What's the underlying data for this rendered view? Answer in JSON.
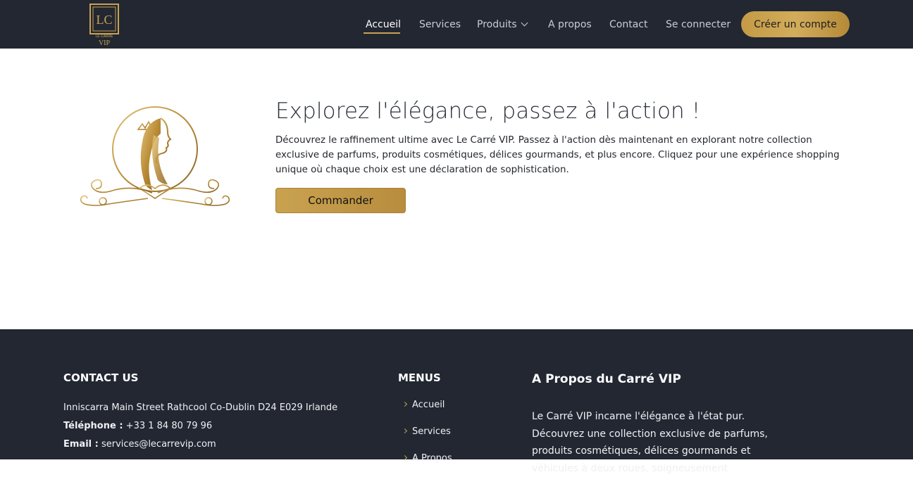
{
  "brand": {
    "logo_letters": "LC",
    "logo_small": "LE CARRÉ",
    "logo_vip": "VIP",
    "gold": "#c9a250",
    "dark": "#222732"
  },
  "nav": {
    "items": [
      {
        "label": "Accueil",
        "active": true
      },
      {
        "label": "Services"
      },
      {
        "label": "Produits",
        "has_dropdown": true
      },
      {
        "label": "A propos"
      },
      {
        "label": "Contact"
      },
      {
        "label": "Se connecter"
      }
    ],
    "cta_label": "Créer un compte"
  },
  "hero": {
    "title": "Explorez l'élégance, passez à l'action !",
    "text": "Découvrez le raffinement ultime avec Le Carré VIP. Passez à l'action dès maintenant en explorant notre collection exclusive de parfums, produits cosmétiques, délices gourmands, et plus encore. Cliquez pour une expérience shopping unique où chaque choix est une déclaration de sophistication.",
    "button_label": "Commander"
  },
  "footer": {
    "contact": {
      "heading": "CONTACT US",
      "address": "Inniscarra Main Street Rathcool Co-Dublin D24 E029 Irlande",
      "phone_label": "Téléphone :",
      "phone": "+33 1 84 80 79 96",
      "email_label": "Email :",
      "email": "services@lecarrevip.com"
    },
    "menus": {
      "heading": "MENUS",
      "items": [
        "Accueil",
        "Services",
        "A Propos"
      ]
    },
    "about": {
      "heading": "A Propos du Carré VIP",
      "text": "Le Carré VIP incarne l'élégance à l'état pur. Découvrez une collection exclusive de parfums, produits cosmétiques, délices gourmands et véhicules à deux roues, soigneusement"
    }
  }
}
